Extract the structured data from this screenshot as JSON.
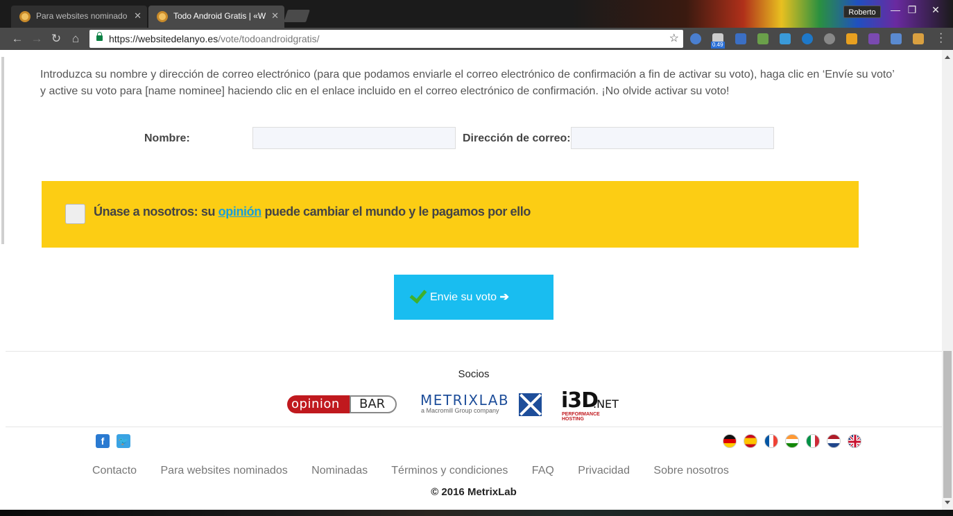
{
  "browser": {
    "tabs": [
      {
        "title": "Para websites nominado"
      },
      {
        "title": "Todo Android Gratis | «W"
      }
    ],
    "user": "Roberto",
    "url_host": "https://websitedelanyo.es",
    "url_path": "/vote/todoandroidgratis/",
    "extension_badge": "0.49"
  },
  "page": {
    "instructions": "Introduzca su nombre y dirección de correo electrónico (para que podamos enviarle el correo electrónico de confirmación a fin de activar su voto), haga clic en ‘Envíe su voto’ y active su voto para [name nominee] haciendo clic en el enlace incluido en el correo electrónico de confirmación. ¡No olvide activar su voto!",
    "form": {
      "name_label": "Nombre:",
      "name_value": "",
      "email_label": "Dirección de correo:",
      "email_value": ""
    },
    "promo": {
      "text_before": "Únase a nosotros: su ",
      "link": "opinión",
      "text_after": " puede cambiar el mundo y le pagamos por ello"
    },
    "vote_button": {
      "label": "Envie su voto",
      "arrow": "➔"
    }
  },
  "footer": {
    "socios_title": "Socios",
    "partners": {
      "opinion_bar": {
        "left": "opinion",
        "right": "BAR"
      },
      "metrixlab": {
        "name": "METRIXLAB",
        "subtitle": "a Macromill Group company"
      },
      "i3d": {
        "name": "i3D",
        "suffix": ".NET",
        "subtitle": "PERFORMANCE HOSTING"
      }
    },
    "social": [
      "facebook-icon",
      "twitter-icon"
    ],
    "languages": [
      "de",
      "es",
      "fr",
      "in",
      "it",
      "nl",
      "gb"
    ],
    "nav": [
      "Contacto",
      "Para websites nominados",
      "Nominadas",
      "Términos y condiciones",
      "FAQ",
      "Privacidad",
      "Sobre nosotros"
    ],
    "copyright": "© 2016 MetrixLab"
  },
  "colors": {
    "promo_bg": "#fccd14",
    "vote_button_bg": "#19bdf0",
    "link": "#1a9fd8"
  }
}
